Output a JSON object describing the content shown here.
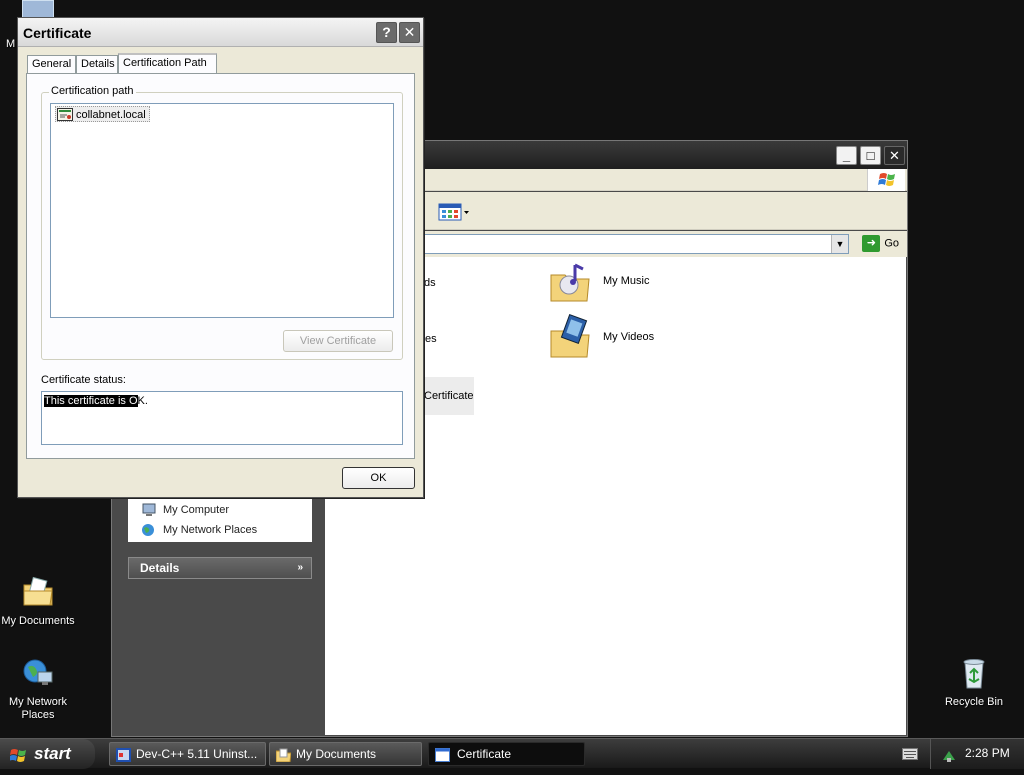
{
  "desktop": {
    "icons": [
      {
        "label": "My Documents"
      },
      {
        "label": "My Network Places"
      },
      {
        "label": "Recycle Bin"
      }
    ],
    "partial_label": "M"
  },
  "explorer": {
    "go_label": "Go",
    "tasks": [
      "My Computer",
      "My Network Places"
    ],
    "details_header": "Details",
    "folders": [
      "My Music",
      "My Videos"
    ],
    "partial_items": [
      "ds",
      "es",
      "Certificate"
    ]
  },
  "certificate_dialog": {
    "title": "Certificate",
    "help_glyph": "?",
    "close_glyph": "✕",
    "tabs": [
      "General",
      "Details",
      "Certification Path"
    ],
    "active_tab": "Certification Path",
    "group_label": "Certification path",
    "tree_items": [
      "collabnet.local"
    ],
    "view_button": "View Certificate",
    "status_label": "Certificate status:",
    "status_selected": "This certificate is O",
    "status_rest": "K.",
    "ok_button": "OK"
  },
  "taskbar": {
    "start_label": "start",
    "tasks": [
      {
        "label": "Dev-C++ 5.11 Uninst...",
        "active": false
      },
      {
        "label": "My Documents",
        "active": false
      },
      {
        "label": "Certificate",
        "active": true
      }
    ],
    "clock": "2:28 PM"
  },
  "colors": {
    "desktop_bg": "#111111",
    "dialog_face": "#ece9d8",
    "selection": "#000000",
    "go_green": "#2f9a2f"
  }
}
